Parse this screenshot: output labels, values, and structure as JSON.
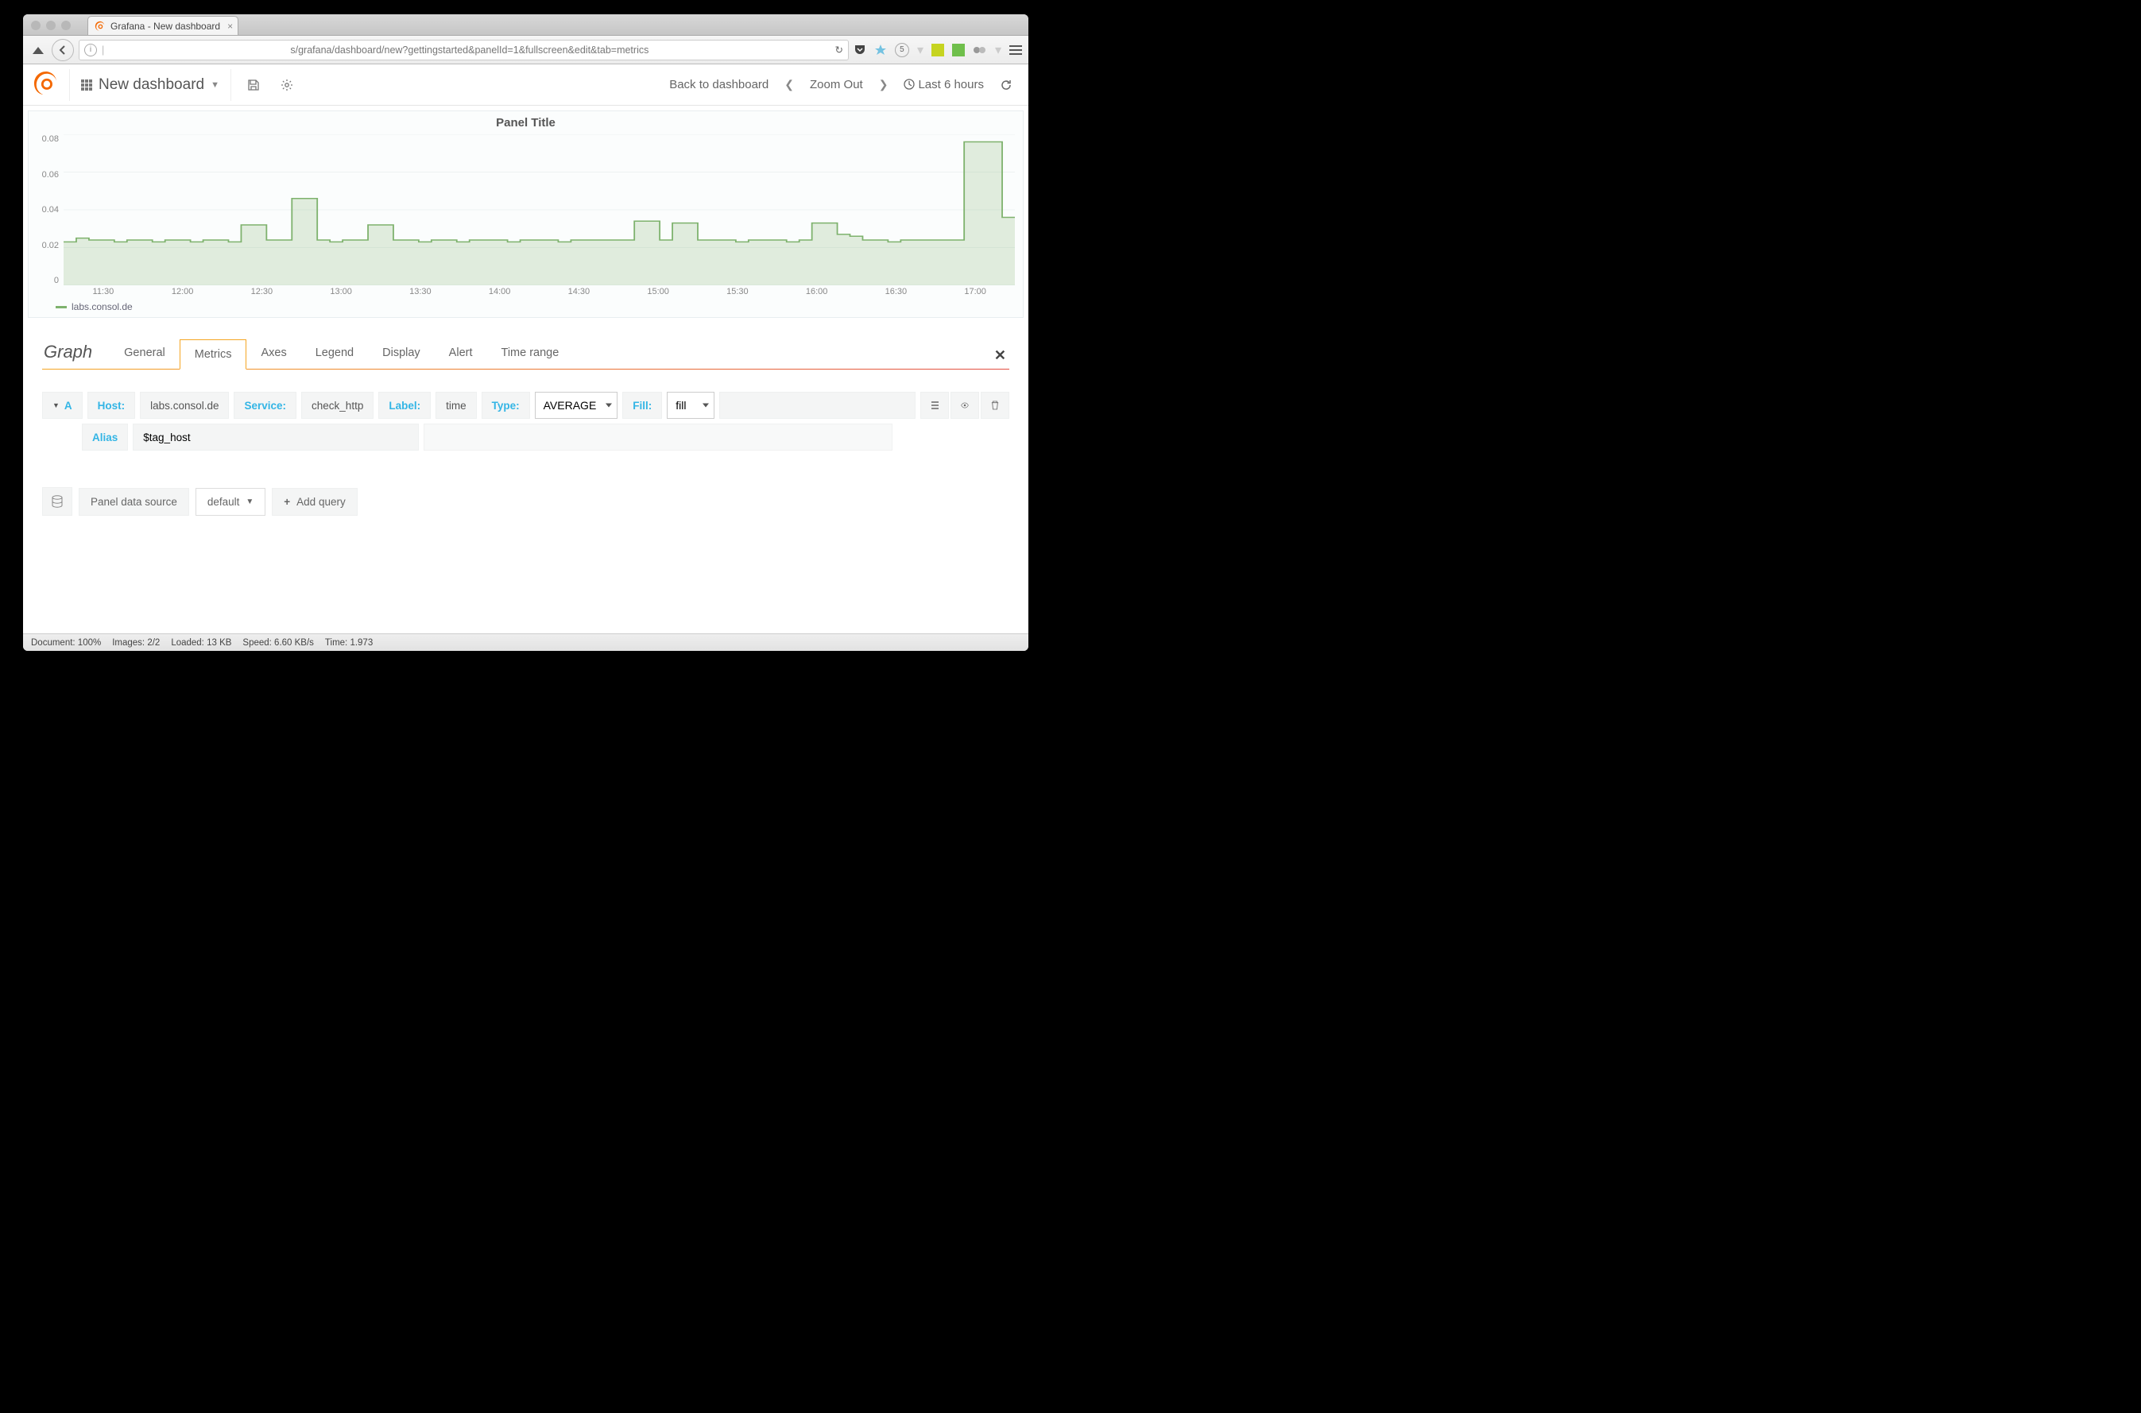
{
  "browser": {
    "tab_title": "Grafana - New dashboard",
    "url": "s/grafana/dashboard/new?gettingstarted&panelId=1&fullscreen&edit&tab=metrics",
    "badge": "5"
  },
  "toolbar": {
    "dashboard_name": "New dashboard",
    "back_link": "Back to dashboard",
    "zoom": "Zoom Out",
    "timerange": "Last 6 hours"
  },
  "panel": {
    "title": "Panel Title",
    "legend_series": "labs.consol.de"
  },
  "editor": {
    "title": "Graph",
    "tabs": [
      "General",
      "Metrics",
      "Axes",
      "Legend",
      "Display",
      "Alert",
      "Time range"
    ],
    "active_tab": "Metrics"
  },
  "query": {
    "letter": "A",
    "host_label": "Host:",
    "host_value": "labs.consol.de",
    "service_label": "Service:",
    "service_value": "check_http",
    "label_label": "Label:",
    "label_value": "time",
    "type_label": "Type:",
    "type_value": "AVERAGE",
    "fill_label": "Fill:",
    "fill_value": "fill",
    "alias_label": "Alias",
    "alias_value": "$tag_host"
  },
  "datasource": {
    "label": "Panel data source",
    "value": "default",
    "add_query": "Add query"
  },
  "status": {
    "doc": "Document: 100%",
    "images": "Images: 2/2",
    "loaded": "Loaded: 13 KB",
    "speed": "Speed: 6.60 KB/s",
    "time": "Time: 1.973"
  },
  "chart_data": {
    "type": "area",
    "title": "Panel Title",
    "xlabel": "",
    "ylabel": "",
    "ylim": [
      0,
      0.08
    ],
    "yticks": [
      0,
      0.02,
      0.04,
      0.06,
      0.08
    ],
    "xticks": [
      "11:30",
      "12:00",
      "12:30",
      "13:00",
      "13:30",
      "14:00",
      "14:30",
      "15:00",
      "15:30",
      "16:00",
      "16:30",
      "17:00"
    ],
    "series": [
      {
        "name": "labs.consol.de",
        "color": "#7eb26d",
        "values": [
          0.023,
          0.025,
          0.024,
          0.024,
          0.023,
          0.024,
          0.024,
          0.023,
          0.024,
          0.024,
          0.023,
          0.024,
          0.024,
          0.023,
          0.032,
          0.032,
          0.024,
          0.024,
          0.046,
          0.046,
          0.024,
          0.023,
          0.024,
          0.024,
          0.032,
          0.032,
          0.024,
          0.024,
          0.023,
          0.024,
          0.024,
          0.023,
          0.024,
          0.024,
          0.024,
          0.023,
          0.024,
          0.024,
          0.024,
          0.023,
          0.024,
          0.024,
          0.024,
          0.024,
          0.024,
          0.034,
          0.034,
          0.024,
          0.033,
          0.033,
          0.024,
          0.024,
          0.024,
          0.023,
          0.024,
          0.024,
          0.024,
          0.023,
          0.024,
          0.033,
          0.033,
          0.027,
          0.026,
          0.024,
          0.024,
          0.023,
          0.024,
          0.024,
          0.024,
          0.024,
          0.024,
          0.076,
          0.076,
          0.076,
          0.036,
          0.036
        ]
      }
    ]
  }
}
